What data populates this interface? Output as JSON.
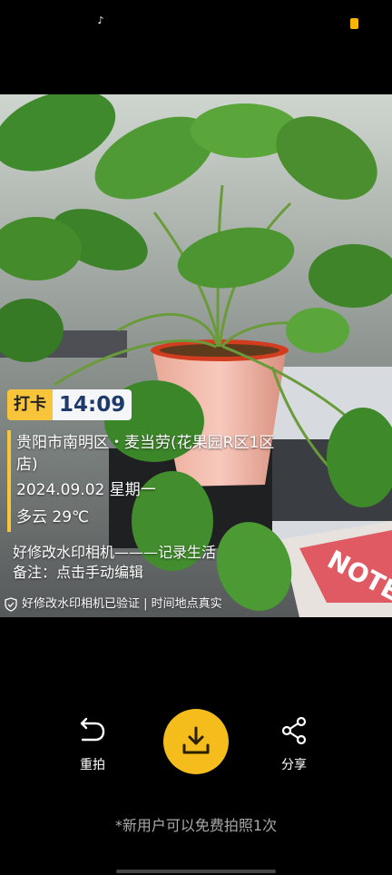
{
  "status_bar": {
    "left_icon": "tiktok-icon",
    "right_icon": "battery-icon",
    "battery_color": "#f6b500"
  },
  "watermark": {
    "tag": "打卡",
    "time": "14:09",
    "location_line1": "贵阳市南明区・麦当劳(花果园R区1区",
    "location_line2": "店)",
    "date": "2024.09.02 星期一",
    "weather": "多云 29℃",
    "slogan": "好修改水印相机———记录生活",
    "note": "备注：点击手动编辑",
    "verify": "好修改水印相机已验证 | 时间地点真实",
    "accent": "#f7c43a"
  },
  "controls": {
    "retake_label": "重拍",
    "share_label": "分享",
    "download_color": "#f5bd1c"
  },
  "footer_note": "*新用户可以免费拍照1次"
}
